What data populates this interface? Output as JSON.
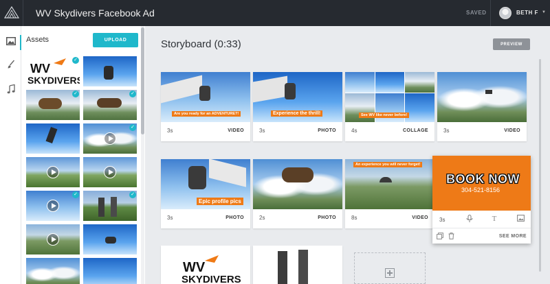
{
  "topbar": {
    "title": "WV Skydivers Facebook Ad",
    "saved": "SAVED",
    "user_name": "BETH F",
    "logo_icon": "prism-logo-icon",
    "caret_icon": "chevron-down-icon"
  },
  "rail": {
    "items": [
      {
        "name": "assets",
        "icon": "image-icon",
        "active": true
      },
      {
        "name": "brush",
        "icon": "brush-icon",
        "active": false
      },
      {
        "name": "music",
        "icon": "music-note-icon",
        "active": false
      }
    ]
  },
  "assets": {
    "title": "Assets",
    "upload_label": "UPLOAD",
    "logo_text_line1": "WV",
    "logo_text_line2": "SKYDIVERS"
  },
  "storyboard": {
    "title": "Storyboard (0:33)",
    "preview_label": "PREVIEW",
    "cards": [
      {
        "duration": "3s",
        "type": "VIDEO",
        "caption": "Are you ready for an ADVENTURE?!"
      },
      {
        "duration": "3s",
        "type": "PHOTO",
        "caption": "Experience the thrill!"
      },
      {
        "duration": "4s",
        "type": "COLLAGE",
        "caption": "See WV like never before!"
      },
      {
        "duration": "3s",
        "type": "VIDEO",
        "caption": ""
      },
      {
        "duration": "3s",
        "type": "PHOTO",
        "caption": "Epic profile pics"
      },
      {
        "duration": "2s",
        "type": "PHOTO",
        "caption": ""
      },
      {
        "duration": "8s",
        "type": "VIDEO",
        "caption": "An experience you will never forget!"
      }
    ],
    "book_card": {
      "title": "BOOK NOW",
      "phone": "304-521-8156",
      "duration": "3s",
      "see_more": "SEE MORE",
      "tools": [
        "microphone-icon",
        "text-icon",
        "image-icon"
      ],
      "actions": [
        "duplicate-icon",
        "trash-icon"
      ]
    },
    "logo_card": {
      "line1": "WV",
      "line2": "SKYDIVERS"
    },
    "add_icon": "add-plus-icon"
  },
  "colors": {
    "accent": "#1fb8cb",
    "orange": "#ee7a17",
    "topbar": "#262a30"
  }
}
